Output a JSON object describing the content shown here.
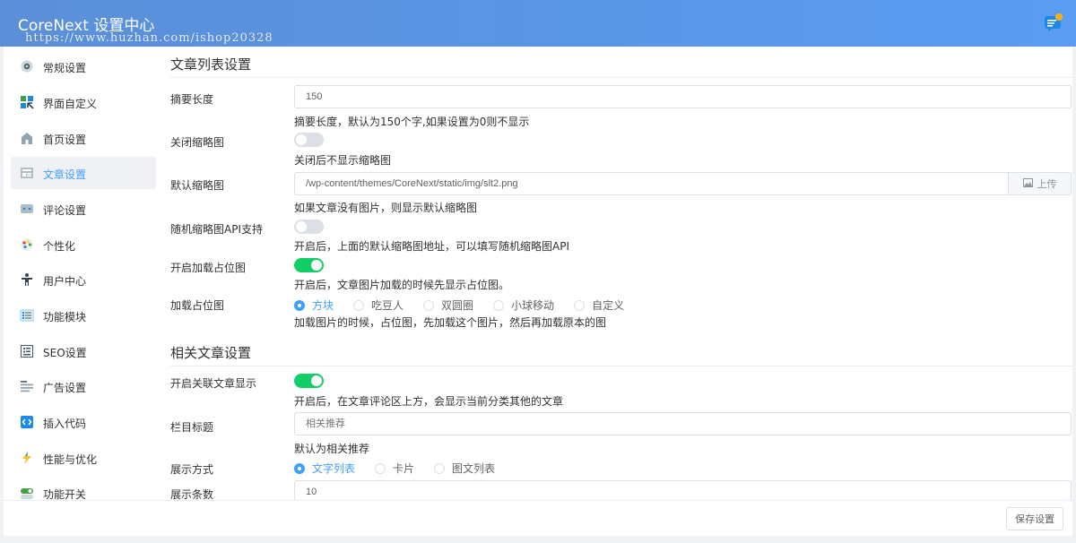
{
  "header": {
    "title": "CoreNext 设置中心",
    "watermark": "https://www.huzhan.com/ishop20328",
    "notification_icon": "notification-list-icon"
  },
  "sidebar": {
    "items": [
      {
        "label": "常规设置",
        "icon": "gear-icon",
        "active": false
      },
      {
        "label": "界面自定义",
        "icon": "layout-grid-icon",
        "active": false
      },
      {
        "label": "首页设置",
        "icon": "home-icon",
        "active": false
      },
      {
        "label": "文章设置",
        "icon": "article-icon",
        "active": true
      },
      {
        "label": "评论设置",
        "icon": "comment-icon",
        "active": false
      },
      {
        "label": "个性化",
        "icon": "palette-icon",
        "active": false
      },
      {
        "label": "用户中心",
        "icon": "user-icon",
        "active": false
      },
      {
        "label": "功能模块",
        "icon": "list-icon",
        "active": false
      },
      {
        "label": "SEO设置",
        "icon": "seo-icon",
        "active": false
      },
      {
        "label": "广告设置",
        "icon": "ad-icon",
        "active": false
      },
      {
        "label": "插入代码",
        "icon": "code-icon",
        "active": false
      },
      {
        "label": "性能与优化",
        "icon": "lightning-icon",
        "active": false
      },
      {
        "label": "功能开关",
        "icon": "toggle-icon",
        "active": false
      }
    ]
  },
  "article_list": {
    "title": "文章列表设置",
    "excerpt_length": {
      "label": "摘要长度",
      "value": "150",
      "help": "摘要长度，默认为150个字,如果设置为0则不显示"
    },
    "close_thumbnail": {
      "label": "关闭缩略图",
      "on": false,
      "help": "关闭后不显示缩略图"
    },
    "default_thumbnail": {
      "label": "默认缩略图",
      "value": "/wp-content/themes/CoreNext/static/img/slt2.png",
      "upload_label": "上传",
      "help": "如果文章没有图片，则显示默认缩略图"
    },
    "random_thumbnail_api": {
      "label": "随机缩略图API支持",
      "on": false,
      "help": "开启后，上面的默认缩略图地址，可以填写随机缩略图API"
    },
    "loading_placeholder": {
      "label": "开启加载占位图",
      "on": true,
      "help": "开启后，文章图片加载的时候先显示占位图。"
    },
    "placeholder_type": {
      "label": "加载占位图",
      "options": [
        "方块",
        "吃豆人",
        "双圆圈",
        "小球移动",
        "自定义"
      ],
      "selected": "方块",
      "help": "加载图片的时候，占位图，先加载这个图片，然后再加载原本的图"
    }
  },
  "related": {
    "title": "相关文章设置",
    "enable": {
      "label": "开启关联文章显示",
      "on": true,
      "help": "开启后，在文章评论区上方，会显示当前分类其他的文章"
    },
    "column_title": {
      "label": "栏目标题",
      "placeholder": "相关推荐",
      "help": "默认为相关推荐"
    },
    "display_mode": {
      "label": "展示方式",
      "options": [
        "文字列表",
        "卡片",
        "图文列表"
      ],
      "selected": "文字列表"
    },
    "display_count": {
      "label": "展示条数",
      "value": "10"
    }
  },
  "footer": {
    "save_label": "保存设置"
  },
  "colors": {
    "accent": "#409eff",
    "switch_on": "#13ce66",
    "header_gradient": "#5a9cf2"
  }
}
